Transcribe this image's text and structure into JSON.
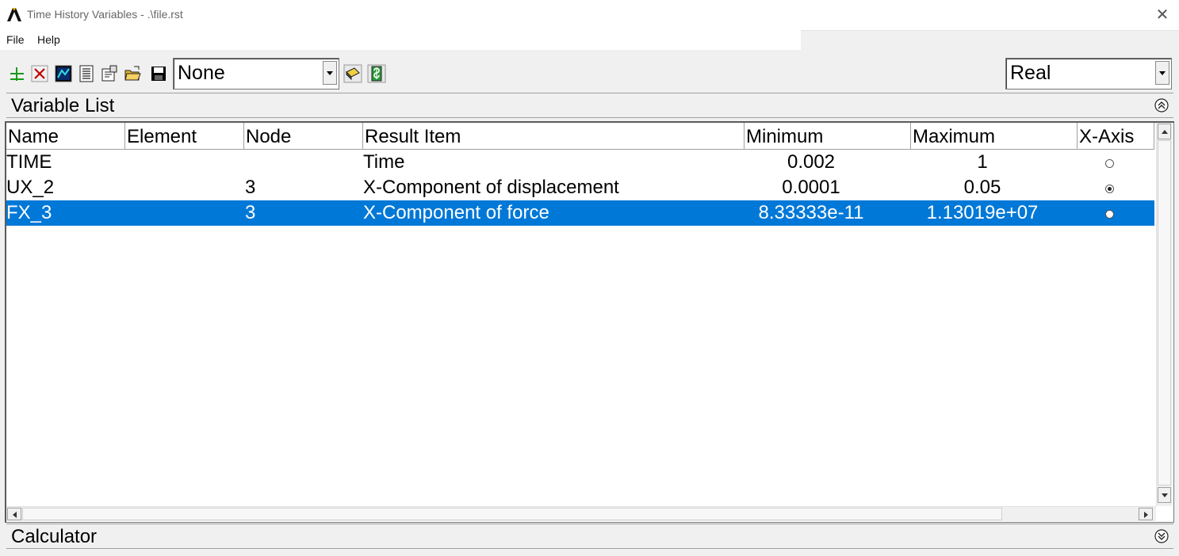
{
  "window": {
    "title": "Time History Variables - .\\file.rst",
    "close_glyph": "✕"
  },
  "menu": {
    "items": [
      "File",
      "Help"
    ]
  },
  "toolbar": {
    "icons": [
      "add-data-icon",
      "delete-data-icon",
      "graph-data-icon",
      "list-data-icon",
      "properties-icon",
      "import-data-icon",
      "save-data-icon",
      "clear-time-history-icon",
      "refresh-icon"
    ],
    "variable_combo_value": "None",
    "data_type_combo_value": "Real"
  },
  "variable_list": {
    "title": "Variable List",
    "columns": [
      "Name",
      "Element",
      "Node",
      "Result Item",
      "Minimum",
      "Maximum",
      "X-Axis"
    ],
    "rows": [
      {
        "name": "TIME",
        "element": "",
        "node": "",
        "result_item": "Time",
        "minimum": "0.002",
        "maximum": "1",
        "x_axis": false,
        "selected": false
      },
      {
        "name": "UX_2",
        "element": "",
        "node": "3",
        "result_item": "X-Component of displacement",
        "minimum": "0.0001",
        "maximum": "0.05",
        "x_axis": true,
        "selected": false
      },
      {
        "name": "FX_3",
        "element": "",
        "node": "3",
        "result_item": "X-Component of force",
        "minimum": "8.33333e-11",
        "maximum": "1.13019e+07",
        "x_axis": false,
        "selected": true
      }
    ]
  },
  "calculator": {
    "title": "Calculator"
  },
  "colors": {
    "selection": "#0078d7",
    "background": "#f0f0f0"
  }
}
